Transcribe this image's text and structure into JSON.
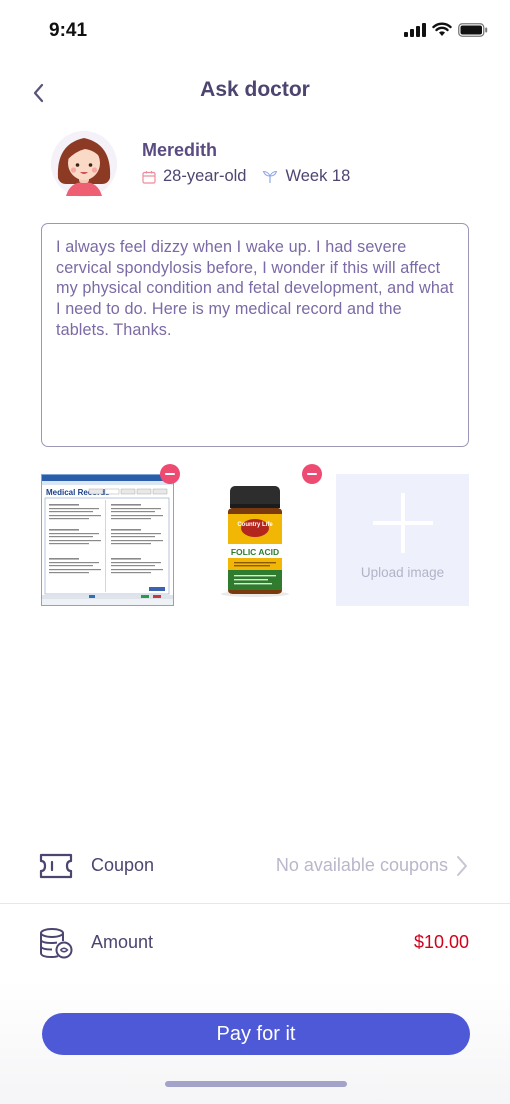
{
  "status_bar": {
    "time": "9:41"
  },
  "nav": {
    "title": "Ask doctor"
  },
  "profile": {
    "name": "Meredith",
    "age": "28-year-old",
    "week": "Week 18"
  },
  "question": {
    "text": "I always feel dizzy when I wake up. I had severe cervical spondylosis before, I wonder if this will affect my physical condition and fetal development, and what I need to do. Here is my medical record and the tablets. Thanks."
  },
  "images": {
    "medical_record_title": "Medical Records",
    "tablet_brand": "Country Life",
    "tablet_label": "FOLIC ACID",
    "upload_label": "Upload image"
  },
  "coupon": {
    "label": "Coupon",
    "value": "No available coupons"
  },
  "amount": {
    "label": "Amount",
    "value": "$10.00"
  },
  "pay": {
    "label": "Pay for it"
  },
  "colors": {
    "accent": "#4d59d6",
    "price": "#d0021b",
    "remove": "#ee4b73",
    "text": "#4d4470"
  }
}
